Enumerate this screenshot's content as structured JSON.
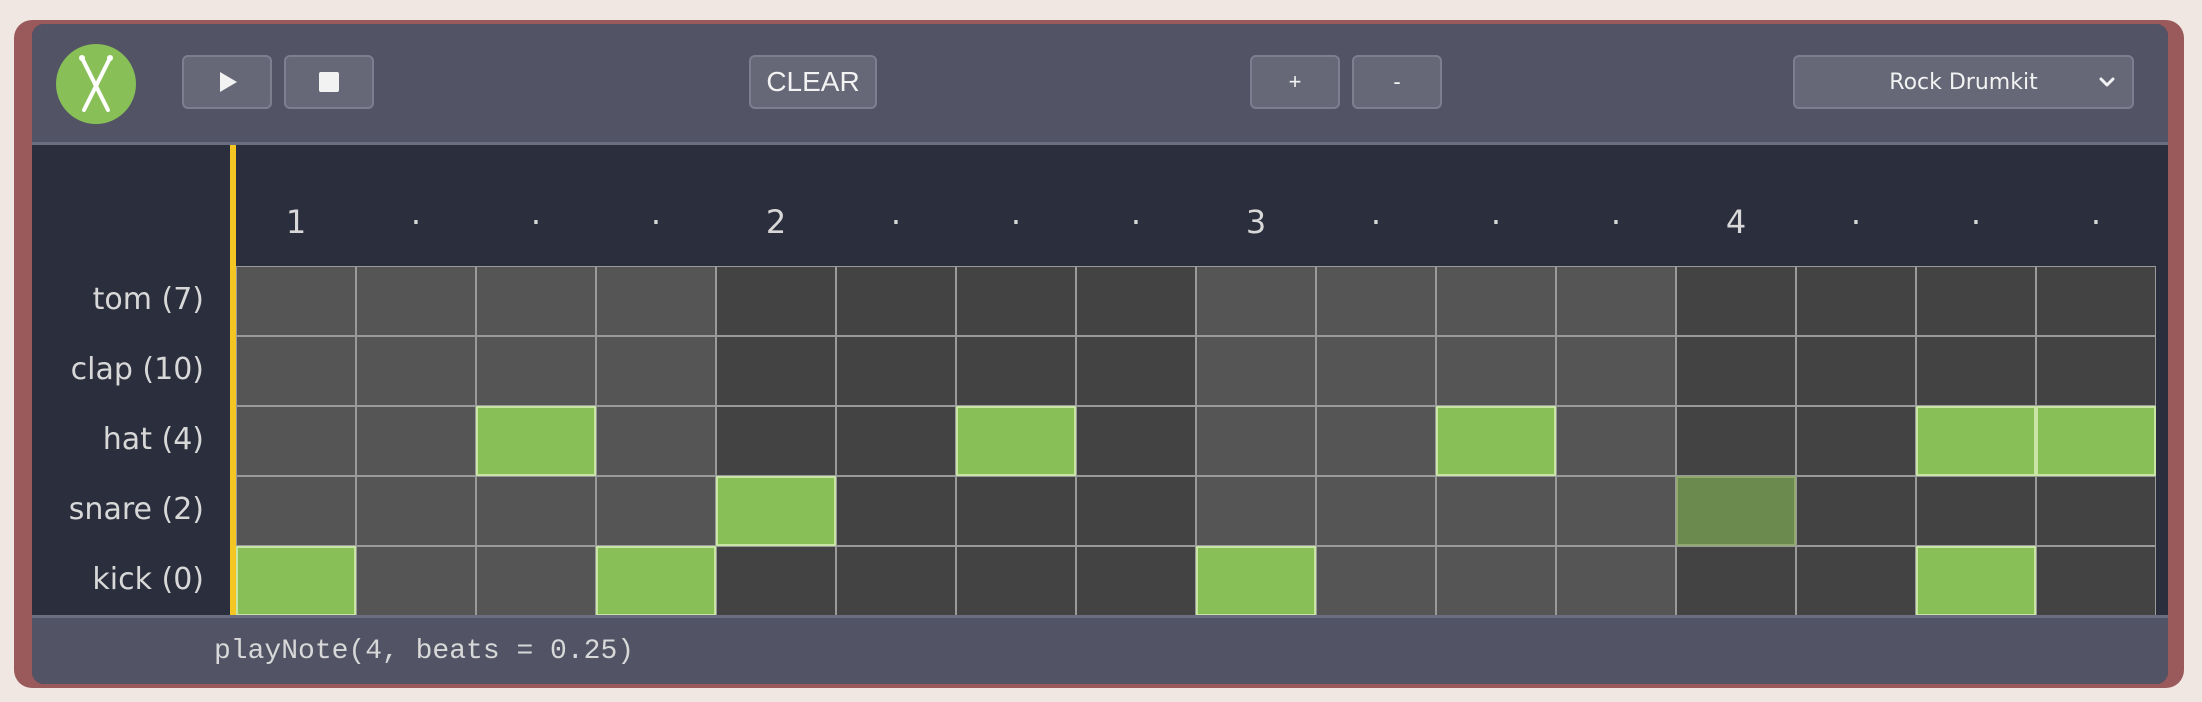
{
  "toolbar": {
    "play_icon": "play-icon",
    "stop_icon": "stop-icon",
    "clear_label": "CLEAR",
    "tempo_up_label": "+",
    "tempo_down_label": "-",
    "kit_select": {
      "selected": "Rock Drumkit",
      "icon": "chevron-down-icon"
    }
  },
  "logo": {
    "icon": "crossed-drumsticks-icon",
    "color": "#88c057"
  },
  "colors": {
    "accent": "#88c057",
    "playhead": "#f3c623",
    "toolbar": "#525466",
    "background": "#2b2e3d"
  },
  "beats": [
    "1",
    "·",
    "·",
    "·",
    "2",
    "·",
    "·",
    "·",
    "3",
    "·",
    "·",
    "·",
    "4",
    "·",
    "·",
    "·"
  ],
  "rows": [
    {
      "label": "tom (7)",
      "steps": [
        0,
        0,
        0,
        0,
        0,
        0,
        0,
        0,
        0,
        0,
        0,
        0,
        0,
        0,
        0,
        0
      ]
    },
    {
      "label": "clap (10)",
      "steps": [
        0,
        0,
        0,
        0,
        0,
        0,
        0,
        0,
        0,
        0,
        0,
        0,
        0,
        0,
        0,
        0
      ]
    },
    {
      "label": "hat (4)",
      "steps": [
        0,
        0,
        1,
        0,
        0,
        0,
        1,
        0,
        0,
        0,
        1,
        0,
        0,
        0,
        1,
        1
      ]
    },
    {
      "label": "snare (2)",
      "steps": [
        0,
        0,
        0,
        0,
        1,
        0,
        0,
        0,
        0,
        0,
        0,
        0,
        2,
        0,
        0,
        0
      ]
    },
    {
      "label": "kick (0)",
      "steps": [
        1,
        0,
        0,
        1,
        0,
        0,
        0,
        0,
        1,
        0,
        0,
        0,
        0,
        0,
        1,
        0
      ]
    }
  ],
  "status": {
    "code": "playNote(4, beats = 0.25)"
  }
}
